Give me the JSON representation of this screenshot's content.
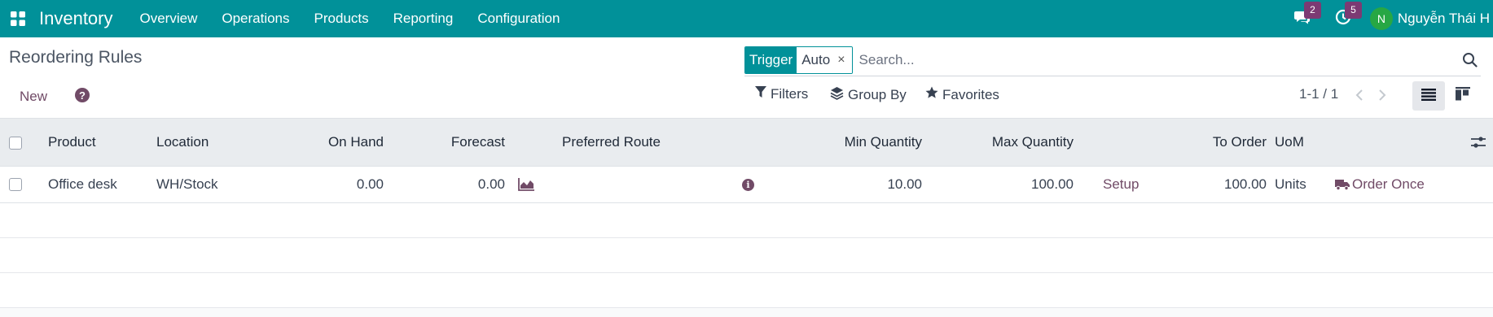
{
  "navbar": {
    "app_name": "Inventory",
    "menu": [
      "Overview",
      "Operations",
      "Products",
      "Reporting",
      "Configuration"
    ],
    "messages_count": "2",
    "activities_count": "5",
    "user_initial": "N",
    "user_name": "Nguyễn Thái H"
  },
  "control_panel": {
    "title": "Reordering Rules",
    "new_label": "New",
    "search": {
      "facet_label": "Trigger",
      "facet_value": "Auto",
      "facet_remove": "×",
      "placeholder": "Search..."
    },
    "filters_label": "Filters",
    "group_by_label": "Group By",
    "favorites_label": "Favorites",
    "pager_value": "1-1 / 1"
  },
  "table": {
    "columns": [
      "Product",
      "Location",
      "On Hand",
      "Forecast",
      "Preferred Route",
      "Min Quantity",
      "Max Quantity",
      "To Order",
      "UoM"
    ],
    "rows": [
      {
        "product": "Office desk",
        "location": "WH/Stock",
        "on_hand": "0.00",
        "forecast": "0.00",
        "preferred_route": "",
        "min_qty": "10.00",
        "max_qty": "100.00",
        "setup_label": "Setup",
        "to_order": "100.00",
        "uom": "Units",
        "order_once_label": "Order Once"
      }
    ],
    "empty_rows": 3
  },
  "colors": {
    "navbar": "#019199",
    "brand": "#714b67",
    "badge": "#7c3a73",
    "avatar": "#27a744"
  },
  "icons": [
    "apps-icon",
    "chat-icon",
    "clock-icon",
    "help-icon",
    "search-icon",
    "filter-icon",
    "layers-icon",
    "star-icon",
    "chevron-left-icon",
    "chevron-right-icon",
    "list-view-icon",
    "kanban-view-icon",
    "settings-sliders-icon",
    "forecast-chart-icon",
    "info-icon",
    "truck-icon"
  ]
}
